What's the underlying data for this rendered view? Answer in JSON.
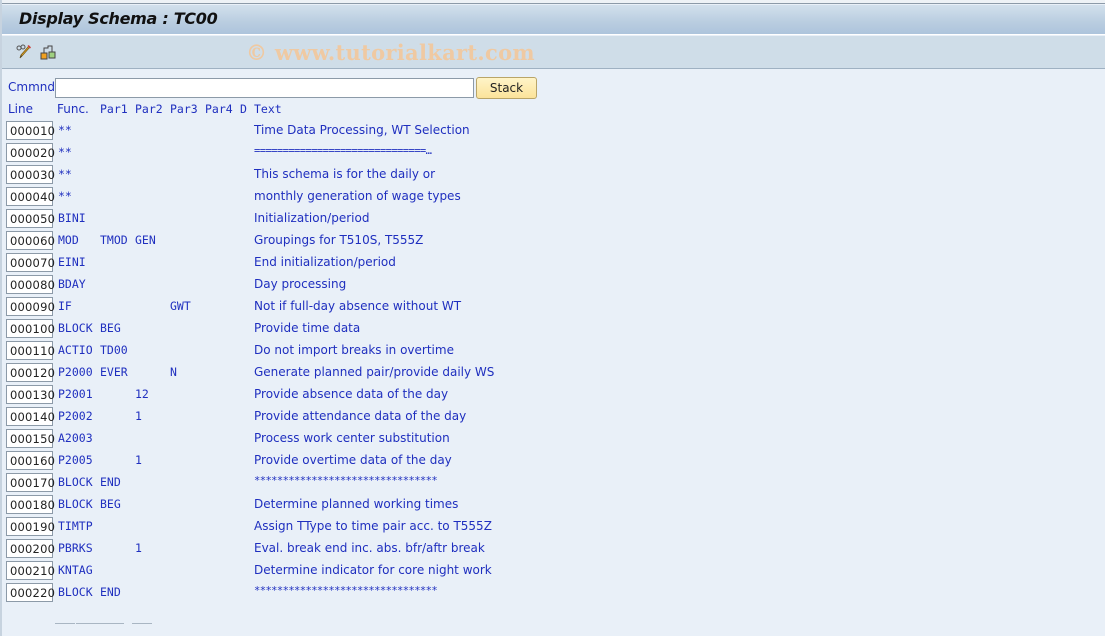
{
  "window": {
    "title": "Display Schema : TC00"
  },
  "toolbar": {
    "buttons": [
      {
        "name": "change-display-toggle",
        "icon": "pencil-glasses-icon"
      },
      {
        "name": "structure-graphic",
        "icon": "hierarchy-icon"
      }
    ]
  },
  "watermark": "© www.tutorialkart.com",
  "command": {
    "label": "Cmmnd",
    "value": "",
    "placeholder": "",
    "stack_label": "Stack"
  },
  "columns": {
    "line": "Line",
    "func": "Func.",
    "par1": "Par1",
    "par2": "Par2",
    "par3": "Par3",
    "par4": "Par4",
    "d": "D",
    "text": "Text"
  },
  "rows": [
    {
      "line": "000010",
      "func": "**",
      "par1": "",
      "par2": "",
      "par3": "",
      "par4": "",
      "d": "",
      "text": "Time Data Processing, WT Selection"
    },
    {
      "line": "000020",
      "func": "**",
      "par1": "",
      "par2": "",
      "par3": "",
      "par4": "",
      "d": "",
      "text": "==============================…"
    },
    {
      "line": "000030",
      "func": "**",
      "par1": "",
      "par2": "",
      "par3": "",
      "par4": "",
      "d": "",
      "text": "This schema is for the daily or"
    },
    {
      "line": "000040",
      "func": "**",
      "par1": "",
      "par2": "",
      "par3": "",
      "par4": "",
      "d": "",
      "text": "monthly generation of wage types"
    },
    {
      "line": "000050",
      "func": "BINI",
      "par1": "",
      "par2": "",
      "par3": "",
      "par4": "",
      "d": "",
      "text": "Initialization/period"
    },
    {
      "line": "000060",
      "func": "MOD",
      "par1": "TMOD",
      "par2": "GEN",
      "par3": "",
      "par4": "",
      "d": "",
      "text": "Groupings for T510S, T555Z"
    },
    {
      "line": "000070",
      "func": "EINI",
      "par1": "",
      "par2": "",
      "par3": "",
      "par4": "",
      "d": "",
      "text": "End initialization/period"
    },
    {
      "line": "000080",
      "func": "BDAY",
      "par1": "",
      "par2": "",
      "par3": "",
      "par4": "",
      "d": "",
      "text": "Day processing"
    },
    {
      "line": "000090",
      "func": "IF",
      "par1": "",
      "par2": "",
      "par3": "GWT",
      "par4": "",
      "d": "",
      "text": "Not if full-day absence without WT"
    },
    {
      "line": "000100",
      "func": "BLOCK",
      "par1": "BEG",
      "par2": "",
      "par3": "",
      "par4": "",
      "d": "",
      "text": "Provide time data"
    },
    {
      "line": "000110",
      "func": "ACTIO",
      "par1": "TD00",
      "par2": "",
      "par3": "",
      "par4": "",
      "d": "",
      "text": "Do not import breaks in overtime"
    },
    {
      "line": "000120",
      "func": "P2000",
      "par1": "EVER",
      "par2": "",
      "par3": "N",
      "par4": "",
      "d": "",
      "text": "Generate planned pair/provide daily WS"
    },
    {
      "line": "000130",
      "func": "P2001",
      "par1": "",
      "par2": "12",
      "par3": "",
      "par4": "",
      "d": "",
      "text": "Provide absence data of the day"
    },
    {
      "line": "000140",
      "func": "P2002",
      "par1": "",
      "par2": "1",
      "par3": "",
      "par4": "",
      "d": "",
      "text": "Provide attendance data of the day"
    },
    {
      "line": "000150",
      "func": "A2003",
      "par1": "",
      "par2": "",
      "par3": "",
      "par4": "",
      "d": "",
      "text": "Process work center substitution"
    },
    {
      "line": "000160",
      "func": "P2005",
      "par1": "",
      "par2": "1",
      "par3": "",
      "par4": "",
      "d": "",
      "text": "Provide overtime data of the day"
    },
    {
      "line": "000170",
      "func": "BLOCK",
      "par1": "END",
      "par2": "",
      "par3": "",
      "par4": "",
      "d": "",
      "text": "********************************"
    },
    {
      "line": "000180",
      "func": "BLOCK",
      "par1": "BEG",
      "par2": "",
      "par3": "",
      "par4": "",
      "d": "",
      "text": "Determine planned working times"
    },
    {
      "line": "000190",
      "func": "TIMTP",
      "par1": "",
      "par2": "",
      "par3": "",
      "par4": "",
      "d": "",
      "text": "Assign TType to time pair acc. to T555Z"
    },
    {
      "line": "000200",
      "func": "PBRKS",
      "par1": "",
      "par2": "1",
      "par3": "",
      "par4": "",
      "d": "",
      "text": "Eval. break end inc. abs. bfr/aftr break"
    },
    {
      "line": "000210",
      "func": "KNTAG",
      "par1": "",
      "par2": "",
      "par3": "",
      "par4": "",
      "d": "",
      "text": "Determine indicator for core night work"
    },
    {
      "line": "000220",
      "func": "BLOCK",
      "par1": "END",
      "par2": "",
      "par3": "",
      "par4": "",
      "d": "",
      "text": "********************************"
    }
  ]
}
